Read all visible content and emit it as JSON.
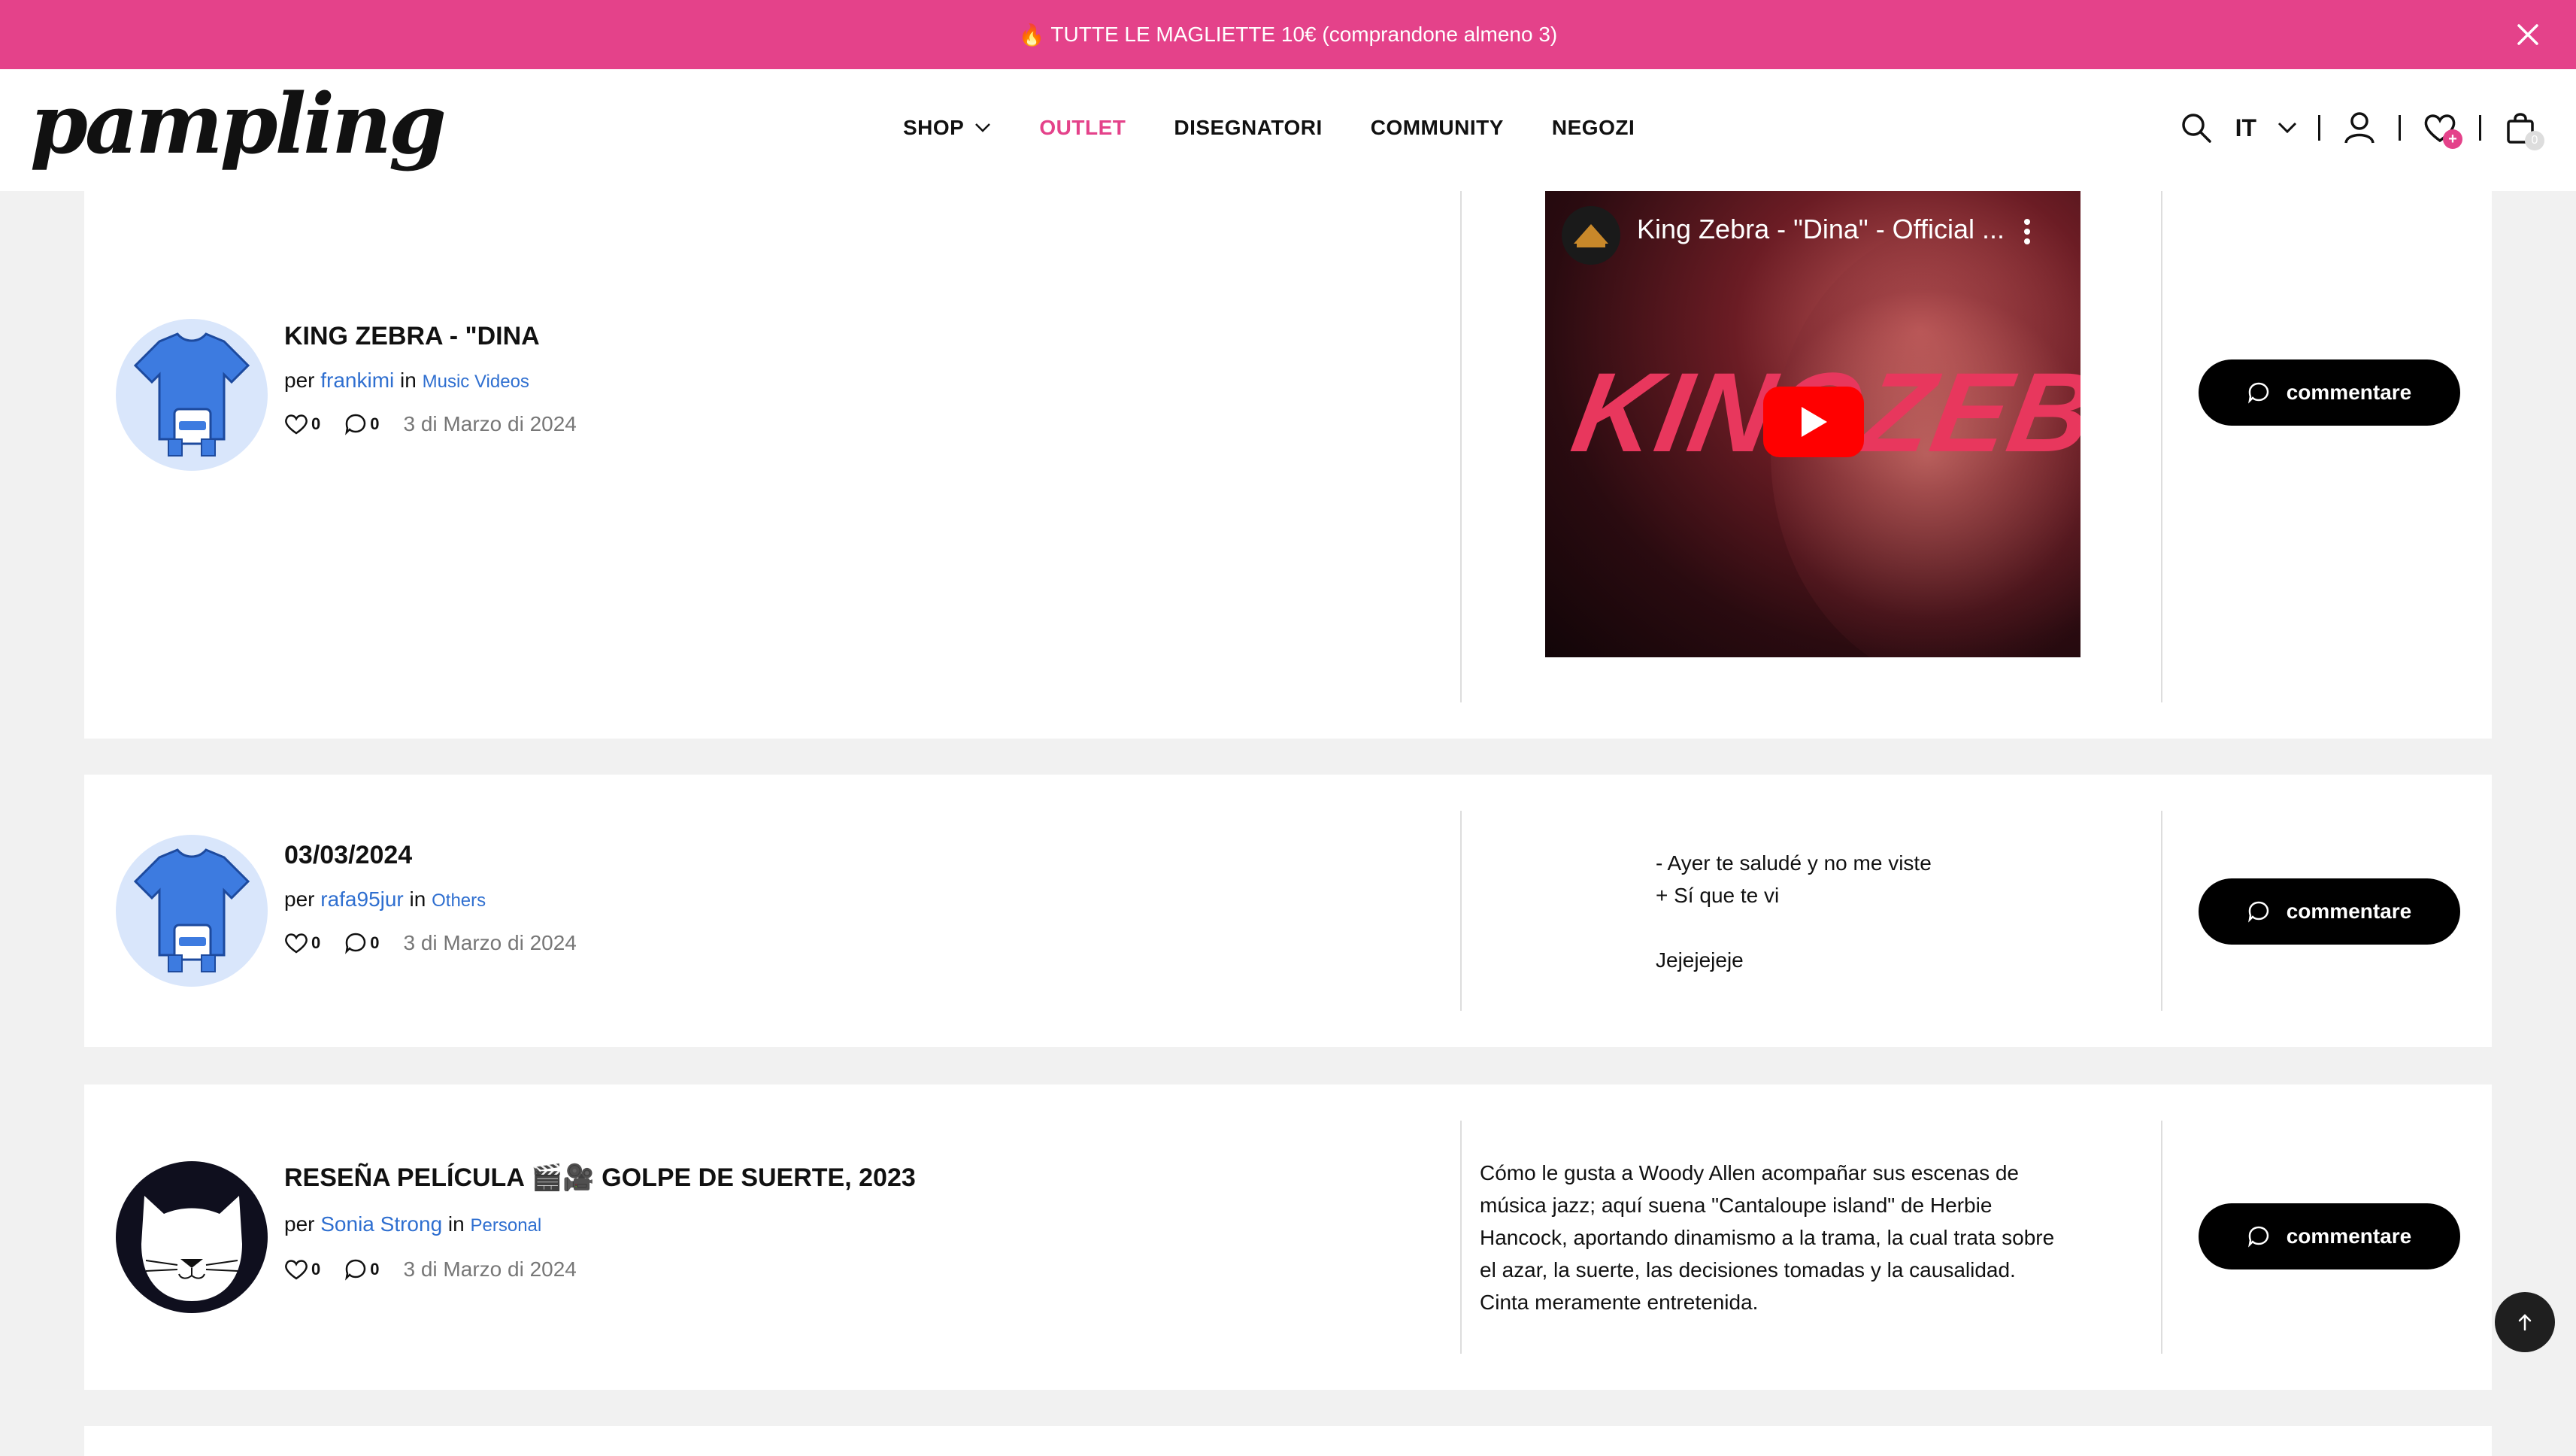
{
  "promo": {
    "emoji": "🔥",
    "text": "TUTTE LE MAGLIETTE 10€ (comprandone almeno 3)"
  },
  "header": {
    "logo": "pampling",
    "nav": {
      "shop": "SHOP",
      "outlet": "OUTLET",
      "designers": "DISEGNATORI",
      "community": "COMMUNITY",
      "stores": "NEGOZI"
    },
    "language": "IT",
    "wishlist_badge": "+",
    "cart_count": "0"
  },
  "posts": [
    {
      "title": "KING ZEBRA - \"DINA",
      "by": "per",
      "author": "frankimi",
      "in": "in",
      "category": "Music Videos",
      "likes": "0",
      "comments": "0",
      "date": "3 di Marzo di 2024",
      "video": {
        "title": "King Zebra - \"Dina\" - Official ...",
        "thumb_text": "KINGZEBRA"
      },
      "button": "commentare"
    },
    {
      "title": "03/03/2024",
      "by": "per",
      "author": "rafa95jur",
      "in": "in",
      "category": "Others",
      "likes": "0",
      "comments": "0",
      "date": "3 di Marzo di 2024",
      "content": "- Ayer te saludé y no me viste\n+ Sí que te vi\n\nJejejejeje",
      "button": "commentare"
    },
    {
      "title": "RESEÑA PELÍCULA 🎬🎥 GOLPE DE SUERTE, 2023",
      "by": "per",
      "author": "Sonia Strong",
      "in": "in",
      "category": "Personal",
      "likes": "0",
      "comments": "0",
      "date": "3 di Marzo di 2024",
      "content": "Cómo le gusta a Woody Allen acompañar sus escenas de\nmúsica jazz; aquí suena \"Cantaloupe island\" de Herbie\nHancock, aportando dinamismo a la trama, la cual trata sobre\nel azar, la suerte, las decisiones tomadas y la causalidad.\nCinta meramente entretenida.",
      "button": "commentare"
    }
  ],
  "colors": {
    "brand_pink": "#e4428a",
    "link_blue": "#2f6fd0",
    "button_black": "#000000"
  }
}
